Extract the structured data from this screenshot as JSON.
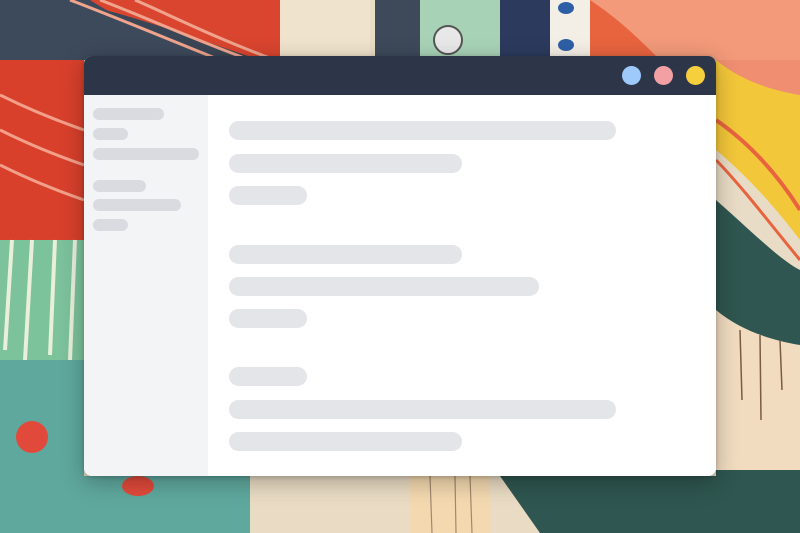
{
  "colors": {
    "titlebar": "#2d3649",
    "window_background": "#ffffff",
    "sidebar_background": "#f3f4f6",
    "placeholder": "#e4e5e9",
    "control_blue": "#9ec9fb",
    "control_pink": "#f2a0a3",
    "control_yellow": "#f6cf3c"
  },
  "window": {
    "controls": [
      {
        "name": "blue-window-control",
        "color": "#9ec9fb"
      },
      {
        "name": "pink-window-control",
        "color": "#f2a0a3"
      },
      {
        "name": "yellow-window-control",
        "color": "#f6cf3c"
      }
    ],
    "sidebar": {
      "groups": [
        {
          "item_count": 3
        },
        {
          "item_count": 3
        }
      ]
    },
    "content": {
      "sections": [
        {
          "line_count": 3
        },
        {
          "line_count": 3
        },
        {
          "line_count": 3
        }
      ]
    }
  }
}
